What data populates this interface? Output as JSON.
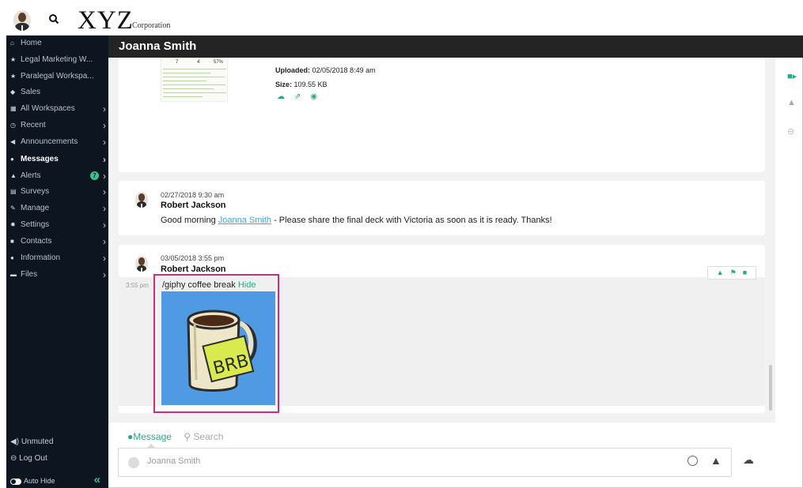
{
  "brand": {
    "name": "XYZ",
    "sub": "Corporation"
  },
  "header": {
    "title": "Joanna Smith"
  },
  "sidebar": {
    "items": [
      {
        "icon": "home-icon",
        "glyph": "⌂",
        "label": "Home",
        "chevron": false
      },
      {
        "icon": "star-icon",
        "glyph": "★",
        "label": "Legal Marketing W...",
        "chevron": false
      },
      {
        "icon": "star-icon",
        "glyph": "★",
        "label": "Paralegal Workspa...",
        "chevron": false
      },
      {
        "icon": "tag-icon",
        "glyph": "◆",
        "label": "Sales",
        "chevron": false
      },
      {
        "icon": "grid-icon",
        "glyph": "▦",
        "label": "All Workspaces",
        "chevron": true
      },
      {
        "icon": "clock-icon",
        "glyph": "◷",
        "label": "Recent",
        "chevron": true
      },
      {
        "icon": "megaphone-icon",
        "glyph": "◀",
        "label": "Announcements",
        "chevron": true
      },
      {
        "icon": "chat-icon",
        "glyph": "●",
        "label": "Messages",
        "chevron": true
      },
      {
        "icon": "alert-icon",
        "glyph": "▲",
        "label": "Alerts",
        "chevron": true,
        "badge": "7"
      },
      {
        "icon": "survey-icon",
        "glyph": "▤",
        "label": "Surveys",
        "chevron": true
      },
      {
        "icon": "pencil-icon",
        "glyph": "✎",
        "label": "Manage",
        "chevron": true
      },
      {
        "icon": "gear-icon",
        "glyph": "✹",
        "label": "Settings",
        "chevron": true
      },
      {
        "icon": "contacts-icon",
        "glyph": "■",
        "label": "Contacts",
        "chevron": true
      },
      {
        "icon": "info-icon",
        "glyph": "●",
        "label": "Information",
        "chevron": true
      },
      {
        "icon": "folder-icon",
        "glyph": "▬",
        "label": "Files",
        "chevron": true
      }
    ],
    "footer": {
      "unmuted": "Unmuted",
      "logout": "Log Out",
      "autohide": "Auto Hide"
    }
  },
  "file_card": {
    "thumb_numbers": [
      "7",
      "4",
      "57%"
    ],
    "uploaded_label": "Uploaded:",
    "uploaded_value": "02/05/2018 8:49 am",
    "size_label": "Size:",
    "size_value": "109.55 KB"
  },
  "messages": [
    {
      "date": "02/27/2018 9:30 am",
      "author": "Robert Jackson",
      "text_before": "Good morning ",
      "mention": "Joanna Smith",
      "text_after": " - Please share the final deck with Victoria as soon as it is ready. Thanks!"
    },
    {
      "date": "03/05/2018 3:55 pm",
      "author": "Robert Jackson",
      "side_time": "3:55 pm",
      "command": "/giphy coffee break ",
      "hide_label": "Hide",
      "gif_text": "BRB"
    }
  ],
  "composer": {
    "tab_message": "Message",
    "tab_search": "Search",
    "placeholder": "Joanna Smith"
  },
  "colors": {
    "accent": "#2aa889",
    "sidebar_bg": "#0d1520",
    "header_bg": "#242424",
    "highlight": "#d42a7a",
    "mention": "#4aa3d9"
  }
}
